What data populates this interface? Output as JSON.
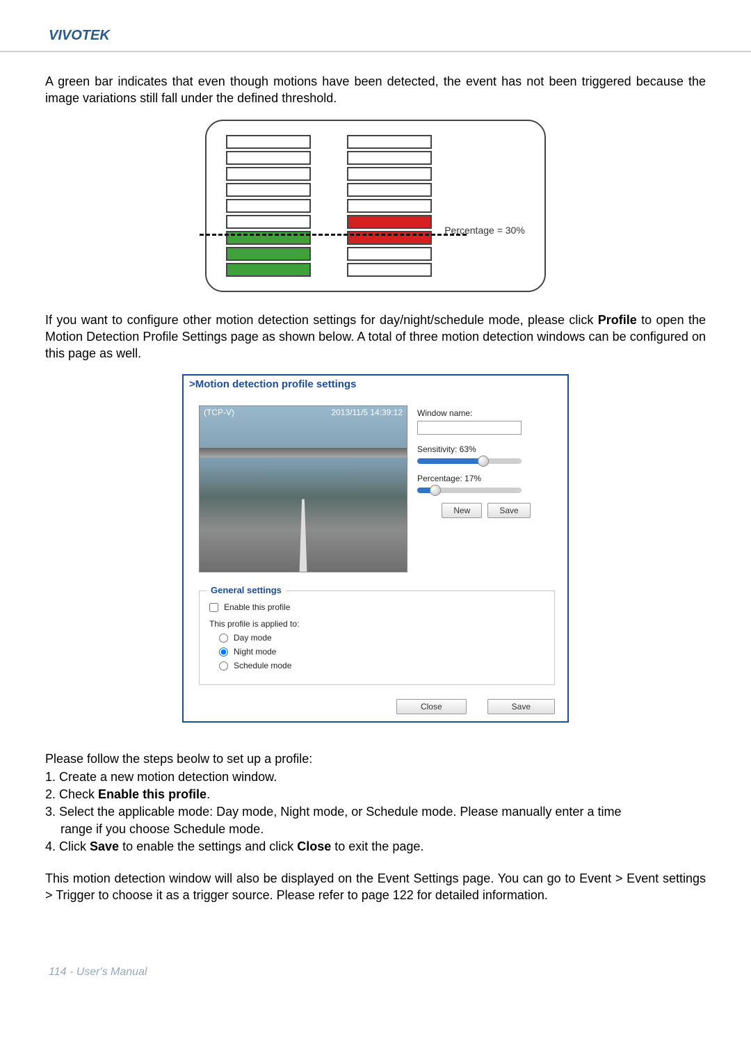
{
  "brand": "VIVOTEK",
  "para1": "A green bar indicates that even though motions have been detected, the event has not been triggered because the image variations still fall under the defined threshold.",
  "diagram": {
    "percentage_label": "Percentage = 30%"
  },
  "para2_pre": "If you want to configure other motion detection settings for day/night/schedule mode, please click ",
  "para2_bold": "Profile",
  "para2_post": " to open the Motion Detection Profile Settings page as shown below. A total of three motion detection windows can be configured on this page as well.",
  "screenshot": {
    "title": ">Motion detection profile settings",
    "osd_left": "(TCP-V)",
    "osd_right": "2013/11/5 14:39:12",
    "window_name_label": "Window name:",
    "window_name_value": "",
    "sensitivity_label": "Sensitivity: 63%",
    "sensitivity_pct": 63,
    "percentage_label": "Percentage: 17%",
    "percentage_pct": 17,
    "new_btn": "New",
    "save_btn": "Save",
    "general_settings_legend": "General settings",
    "enable_label": "Enable this profile",
    "applied_label": "This profile is applied to:",
    "mode_day": "Day mode",
    "mode_night": "Night mode",
    "mode_schedule": "Schedule mode",
    "close_btn": "Close",
    "footer_save_btn": "Save"
  },
  "steps_intro": "Please follow the steps beolw to set up a profile:",
  "step1": "1. Create a new motion detection window.",
  "step2_pre": "2. Check ",
  "step2_bold": "Enable this profile",
  "step2_post": ".",
  "step3_a": "3. Select the applicable mode: Day mode, Night mode, or Schedule mode. Please manually enter a time",
  "step3_b": "range if you choose Schedule mode.",
  "step4_pre": "4. Click ",
  "step4_b1": "Save",
  "step4_mid": " to enable the settings and click ",
  "step4_b2": "Close",
  "step4_post": " to exit the page.",
  "para3": "This motion detection window will also be displayed on the Event Settings page. You can go to Event > Event settings > Trigger to choose it as a trigger source. Please refer to page 122 for detailed information.",
  "footer": "114 - User's Manual"
}
